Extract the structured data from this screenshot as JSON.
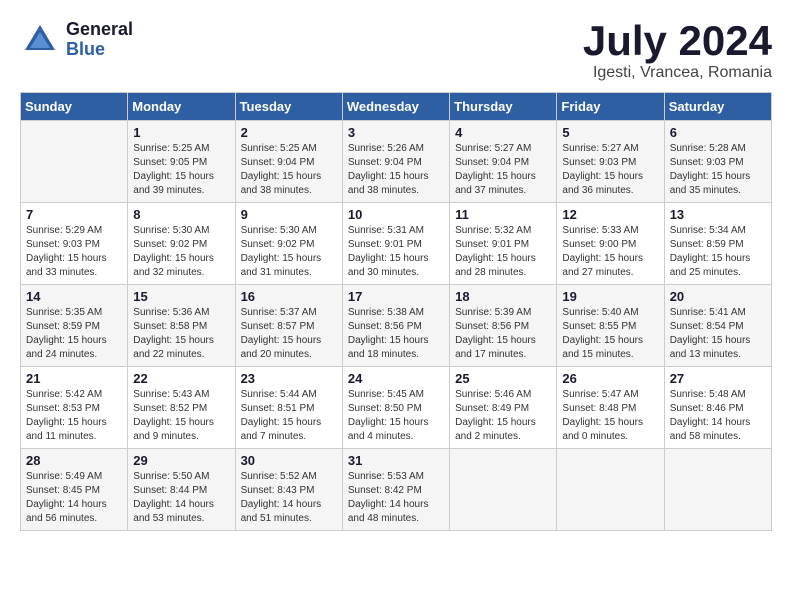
{
  "header": {
    "logo_line1": "General",
    "logo_line2": "Blue",
    "month": "July 2024",
    "location": "Igesti, Vrancea, Romania"
  },
  "weekdays": [
    "Sunday",
    "Monday",
    "Tuesday",
    "Wednesday",
    "Thursday",
    "Friday",
    "Saturday"
  ],
  "weeks": [
    [
      {
        "day": "",
        "info": ""
      },
      {
        "day": "1",
        "info": "Sunrise: 5:25 AM\nSunset: 9:05 PM\nDaylight: 15 hours\nand 39 minutes."
      },
      {
        "day": "2",
        "info": "Sunrise: 5:25 AM\nSunset: 9:04 PM\nDaylight: 15 hours\nand 38 minutes."
      },
      {
        "day": "3",
        "info": "Sunrise: 5:26 AM\nSunset: 9:04 PM\nDaylight: 15 hours\nand 38 minutes."
      },
      {
        "day": "4",
        "info": "Sunrise: 5:27 AM\nSunset: 9:04 PM\nDaylight: 15 hours\nand 37 minutes."
      },
      {
        "day": "5",
        "info": "Sunrise: 5:27 AM\nSunset: 9:03 PM\nDaylight: 15 hours\nand 36 minutes."
      },
      {
        "day": "6",
        "info": "Sunrise: 5:28 AM\nSunset: 9:03 PM\nDaylight: 15 hours\nand 35 minutes."
      }
    ],
    [
      {
        "day": "7",
        "info": "Sunrise: 5:29 AM\nSunset: 9:03 PM\nDaylight: 15 hours\nand 33 minutes."
      },
      {
        "day": "8",
        "info": "Sunrise: 5:30 AM\nSunset: 9:02 PM\nDaylight: 15 hours\nand 32 minutes."
      },
      {
        "day": "9",
        "info": "Sunrise: 5:30 AM\nSunset: 9:02 PM\nDaylight: 15 hours\nand 31 minutes."
      },
      {
        "day": "10",
        "info": "Sunrise: 5:31 AM\nSunset: 9:01 PM\nDaylight: 15 hours\nand 30 minutes."
      },
      {
        "day": "11",
        "info": "Sunrise: 5:32 AM\nSunset: 9:01 PM\nDaylight: 15 hours\nand 28 minutes."
      },
      {
        "day": "12",
        "info": "Sunrise: 5:33 AM\nSunset: 9:00 PM\nDaylight: 15 hours\nand 27 minutes."
      },
      {
        "day": "13",
        "info": "Sunrise: 5:34 AM\nSunset: 8:59 PM\nDaylight: 15 hours\nand 25 minutes."
      }
    ],
    [
      {
        "day": "14",
        "info": "Sunrise: 5:35 AM\nSunset: 8:59 PM\nDaylight: 15 hours\nand 24 minutes."
      },
      {
        "day": "15",
        "info": "Sunrise: 5:36 AM\nSunset: 8:58 PM\nDaylight: 15 hours\nand 22 minutes."
      },
      {
        "day": "16",
        "info": "Sunrise: 5:37 AM\nSunset: 8:57 PM\nDaylight: 15 hours\nand 20 minutes."
      },
      {
        "day": "17",
        "info": "Sunrise: 5:38 AM\nSunset: 8:56 PM\nDaylight: 15 hours\nand 18 minutes."
      },
      {
        "day": "18",
        "info": "Sunrise: 5:39 AM\nSunset: 8:56 PM\nDaylight: 15 hours\nand 17 minutes."
      },
      {
        "day": "19",
        "info": "Sunrise: 5:40 AM\nSunset: 8:55 PM\nDaylight: 15 hours\nand 15 minutes."
      },
      {
        "day": "20",
        "info": "Sunrise: 5:41 AM\nSunset: 8:54 PM\nDaylight: 15 hours\nand 13 minutes."
      }
    ],
    [
      {
        "day": "21",
        "info": "Sunrise: 5:42 AM\nSunset: 8:53 PM\nDaylight: 15 hours\nand 11 minutes."
      },
      {
        "day": "22",
        "info": "Sunrise: 5:43 AM\nSunset: 8:52 PM\nDaylight: 15 hours\nand 9 minutes."
      },
      {
        "day": "23",
        "info": "Sunrise: 5:44 AM\nSunset: 8:51 PM\nDaylight: 15 hours\nand 7 minutes."
      },
      {
        "day": "24",
        "info": "Sunrise: 5:45 AM\nSunset: 8:50 PM\nDaylight: 15 hours\nand 4 minutes."
      },
      {
        "day": "25",
        "info": "Sunrise: 5:46 AM\nSunset: 8:49 PM\nDaylight: 15 hours\nand 2 minutes."
      },
      {
        "day": "26",
        "info": "Sunrise: 5:47 AM\nSunset: 8:48 PM\nDaylight: 15 hours\nand 0 minutes."
      },
      {
        "day": "27",
        "info": "Sunrise: 5:48 AM\nSunset: 8:46 PM\nDaylight: 14 hours\nand 58 minutes."
      }
    ],
    [
      {
        "day": "28",
        "info": "Sunrise: 5:49 AM\nSunset: 8:45 PM\nDaylight: 14 hours\nand 56 minutes."
      },
      {
        "day": "29",
        "info": "Sunrise: 5:50 AM\nSunset: 8:44 PM\nDaylight: 14 hours\nand 53 minutes."
      },
      {
        "day": "30",
        "info": "Sunrise: 5:52 AM\nSunset: 8:43 PM\nDaylight: 14 hours\nand 51 minutes."
      },
      {
        "day": "31",
        "info": "Sunrise: 5:53 AM\nSunset: 8:42 PM\nDaylight: 14 hours\nand 48 minutes."
      },
      {
        "day": "",
        "info": ""
      },
      {
        "day": "",
        "info": ""
      },
      {
        "day": "",
        "info": ""
      }
    ]
  ]
}
